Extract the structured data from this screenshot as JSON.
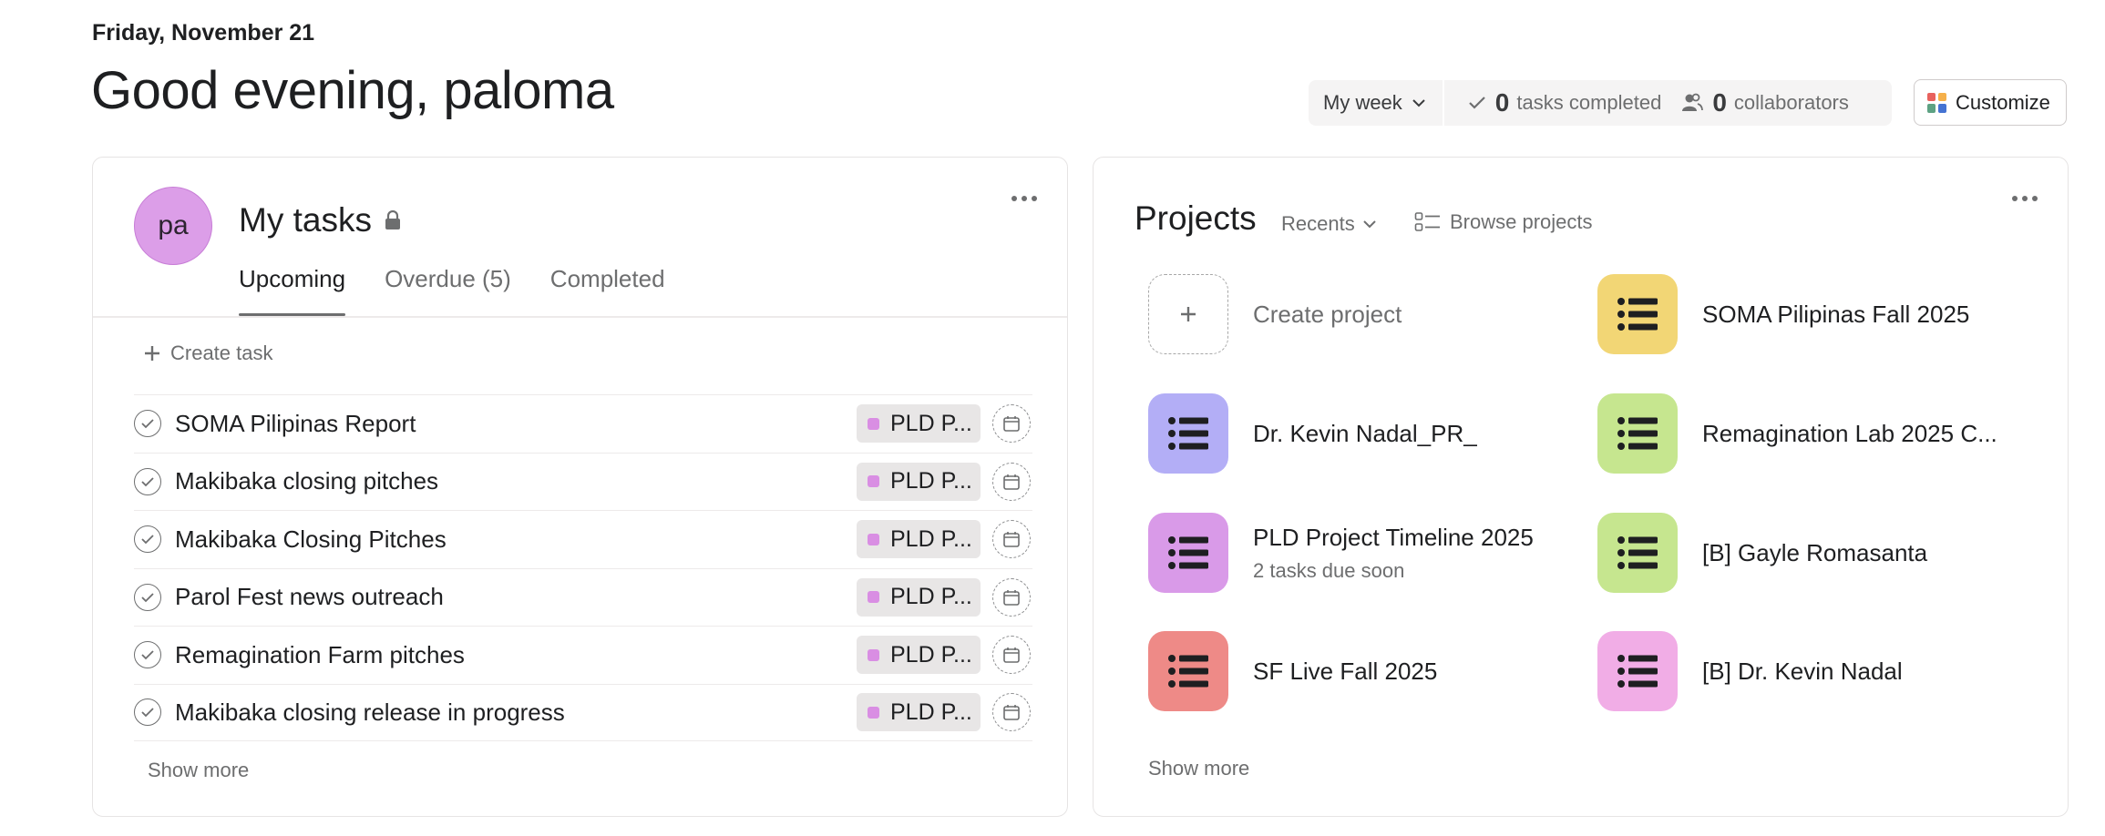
{
  "header": {
    "date": "Friday, November 21",
    "greeting": "Good evening, paloma"
  },
  "stats": {
    "period_label": "My week",
    "tasks_completed_count": "0",
    "tasks_completed_label": "tasks completed",
    "collaborators_count": "0",
    "collaborators_label": "collaborators"
  },
  "customize_label": "Customize",
  "my_tasks": {
    "avatar_initials": "pa",
    "title": "My tasks",
    "tabs": [
      {
        "label": "Upcoming",
        "active": true
      },
      {
        "label": "Overdue (5)",
        "active": false
      },
      {
        "label": "Completed",
        "active": false
      }
    ],
    "create_label": "Create task",
    "tasks": [
      {
        "name": "SOMA Pilipinas Report",
        "project": "PLD P..."
      },
      {
        "name": "Makibaka closing pitches",
        "project": "PLD P..."
      },
      {
        "name": "Makibaka Closing Pitches",
        "project": "PLD P..."
      },
      {
        "name": "Parol Fest news outreach",
        "project": "PLD P..."
      },
      {
        "name": "Remagination Farm pitches",
        "project": "PLD P..."
      },
      {
        "name": "Makibaka closing release in progress",
        "project": "PLD P..."
      }
    ],
    "show_more": "Show more"
  },
  "projects": {
    "title": "Projects",
    "filter_label": "Recents",
    "browse_label": "Browse projects",
    "create_label": "Create project",
    "items": [
      {
        "name": "SOMA Pilipinas Fall 2025",
        "subtitle": "",
        "color": "#f2d675"
      },
      {
        "name": "Dr. Kevin Nadal_PR_",
        "subtitle": "",
        "color": "#b3aef6"
      },
      {
        "name": "Remagination Lab 2025 C...",
        "subtitle": "",
        "color": "#c6e68f"
      },
      {
        "name": "PLD Project Timeline 2025",
        "subtitle": "2 tasks due soon",
        "color": "#d99ae8"
      },
      {
        "name": "[B] Gayle Romasanta",
        "subtitle": "",
        "color": "#c6e68f"
      },
      {
        "name": "SF Live Fall 2025",
        "subtitle": "",
        "color": "#ee8a87"
      },
      {
        "name": "[B] Dr. Kevin Nadal",
        "subtitle": "",
        "color": "#f1ade6"
      }
    ],
    "show_more": "Show more"
  },
  "colors": {
    "avatar": "#dc9ee8",
    "tag_dot": "#d98ee3",
    "customize_icon": [
      "#e8625e",
      "#f5b04a",
      "#5da283",
      "#4573d2"
    ]
  }
}
